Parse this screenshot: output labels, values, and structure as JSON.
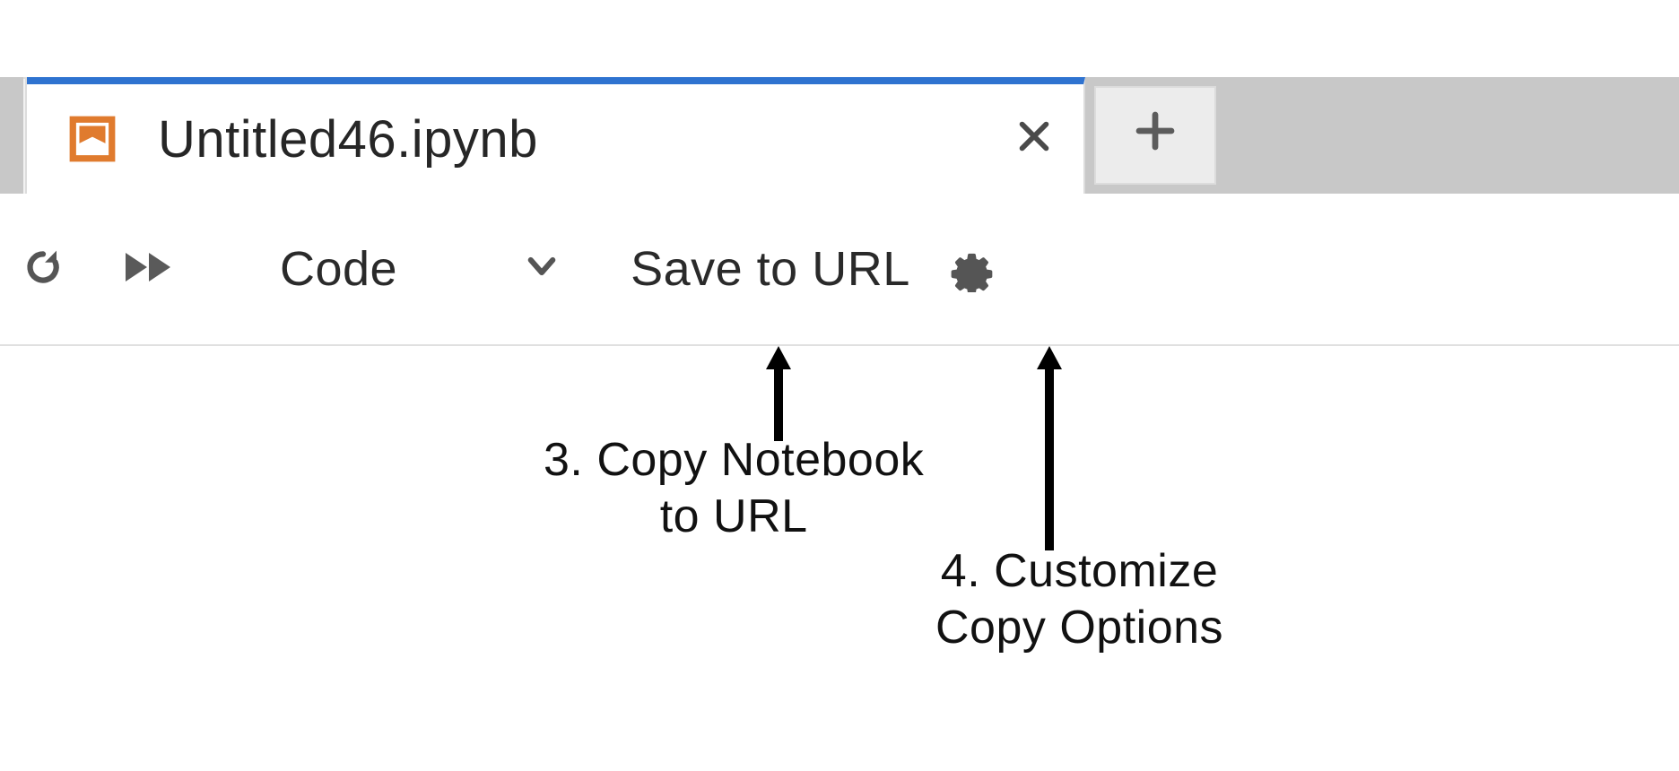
{
  "tabs": {
    "active": {
      "title": "Untitled46.ipynb"
    }
  },
  "toolbar": {
    "celltype": {
      "value": "Code"
    },
    "save_to_url_label": "Save to URL"
  },
  "annotations": {
    "arrow1_label": "3. Copy Notebook\nto URL",
    "arrow2_label": "4. Customize\nCopy Options"
  }
}
